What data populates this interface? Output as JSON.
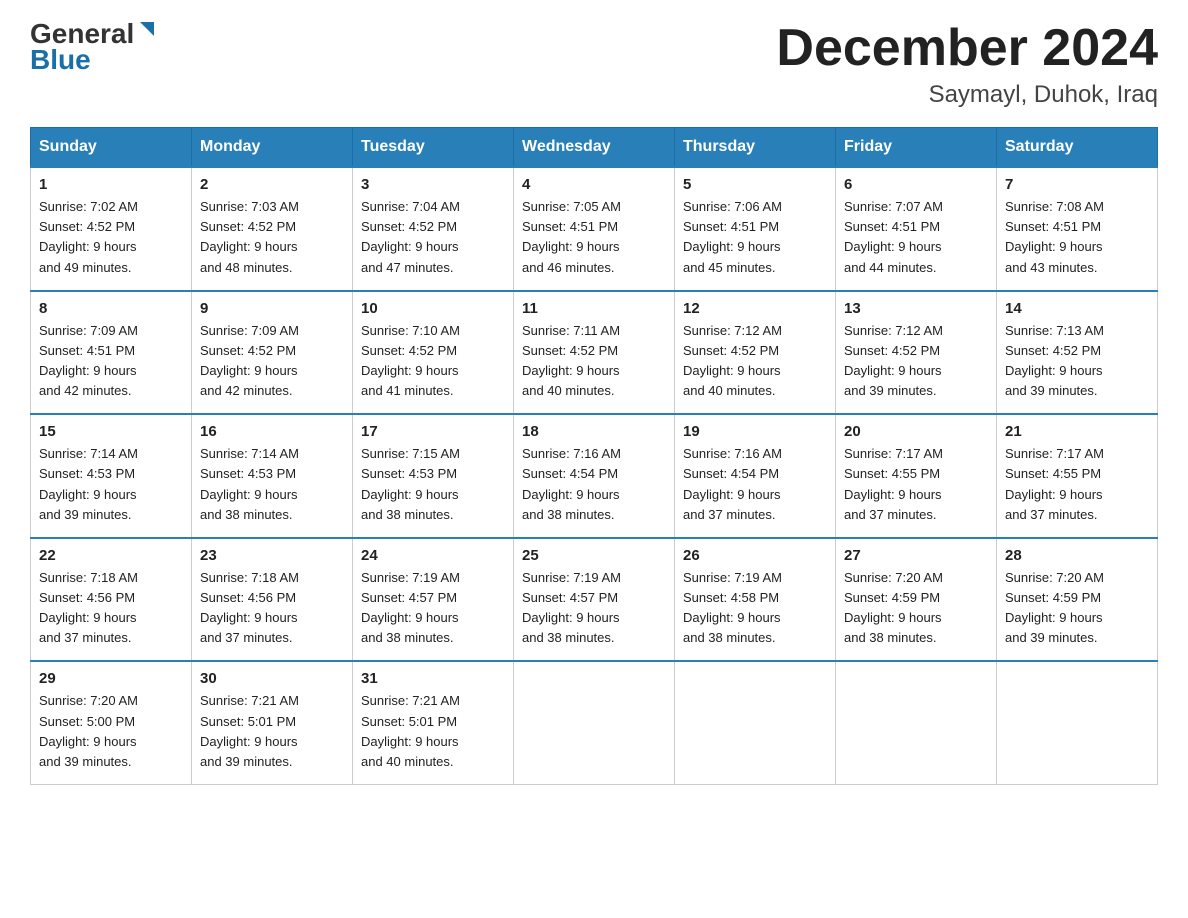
{
  "header": {
    "logo_general": "General",
    "logo_blue": "Blue",
    "month_title": "December 2024",
    "location": "Saymayl, Duhok, Iraq"
  },
  "days_of_week": [
    "Sunday",
    "Monday",
    "Tuesday",
    "Wednesday",
    "Thursday",
    "Friday",
    "Saturday"
  ],
  "weeks": [
    [
      {
        "day": "1",
        "sunrise": "7:02 AM",
        "sunset": "4:52 PM",
        "daylight": "9 hours and 49 minutes."
      },
      {
        "day": "2",
        "sunrise": "7:03 AM",
        "sunset": "4:52 PM",
        "daylight": "9 hours and 48 minutes."
      },
      {
        "day": "3",
        "sunrise": "7:04 AM",
        "sunset": "4:52 PM",
        "daylight": "9 hours and 47 minutes."
      },
      {
        "day": "4",
        "sunrise": "7:05 AM",
        "sunset": "4:51 PM",
        "daylight": "9 hours and 46 minutes."
      },
      {
        "day": "5",
        "sunrise": "7:06 AM",
        "sunset": "4:51 PM",
        "daylight": "9 hours and 45 minutes."
      },
      {
        "day": "6",
        "sunrise": "7:07 AM",
        "sunset": "4:51 PM",
        "daylight": "9 hours and 44 minutes."
      },
      {
        "day": "7",
        "sunrise": "7:08 AM",
        "sunset": "4:51 PM",
        "daylight": "9 hours and 43 minutes."
      }
    ],
    [
      {
        "day": "8",
        "sunrise": "7:09 AM",
        "sunset": "4:51 PM",
        "daylight": "9 hours and 42 minutes."
      },
      {
        "day": "9",
        "sunrise": "7:09 AM",
        "sunset": "4:52 PM",
        "daylight": "9 hours and 42 minutes."
      },
      {
        "day": "10",
        "sunrise": "7:10 AM",
        "sunset": "4:52 PM",
        "daylight": "9 hours and 41 minutes."
      },
      {
        "day": "11",
        "sunrise": "7:11 AM",
        "sunset": "4:52 PM",
        "daylight": "9 hours and 40 minutes."
      },
      {
        "day": "12",
        "sunrise": "7:12 AM",
        "sunset": "4:52 PM",
        "daylight": "9 hours and 40 minutes."
      },
      {
        "day": "13",
        "sunrise": "7:12 AM",
        "sunset": "4:52 PM",
        "daylight": "9 hours and 39 minutes."
      },
      {
        "day": "14",
        "sunrise": "7:13 AM",
        "sunset": "4:52 PM",
        "daylight": "9 hours and 39 minutes."
      }
    ],
    [
      {
        "day": "15",
        "sunrise": "7:14 AM",
        "sunset": "4:53 PM",
        "daylight": "9 hours and 39 minutes."
      },
      {
        "day": "16",
        "sunrise": "7:14 AM",
        "sunset": "4:53 PM",
        "daylight": "9 hours and 38 minutes."
      },
      {
        "day": "17",
        "sunrise": "7:15 AM",
        "sunset": "4:53 PM",
        "daylight": "9 hours and 38 minutes."
      },
      {
        "day": "18",
        "sunrise": "7:16 AM",
        "sunset": "4:54 PM",
        "daylight": "9 hours and 38 minutes."
      },
      {
        "day": "19",
        "sunrise": "7:16 AM",
        "sunset": "4:54 PM",
        "daylight": "9 hours and 37 minutes."
      },
      {
        "day": "20",
        "sunrise": "7:17 AM",
        "sunset": "4:55 PM",
        "daylight": "9 hours and 37 minutes."
      },
      {
        "day": "21",
        "sunrise": "7:17 AM",
        "sunset": "4:55 PM",
        "daylight": "9 hours and 37 minutes."
      }
    ],
    [
      {
        "day": "22",
        "sunrise": "7:18 AM",
        "sunset": "4:56 PM",
        "daylight": "9 hours and 37 minutes."
      },
      {
        "day": "23",
        "sunrise": "7:18 AM",
        "sunset": "4:56 PM",
        "daylight": "9 hours and 37 minutes."
      },
      {
        "day": "24",
        "sunrise": "7:19 AM",
        "sunset": "4:57 PM",
        "daylight": "9 hours and 38 minutes."
      },
      {
        "day": "25",
        "sunrise": "7:19 AM",
        "sunset": "4:57 PM",
        "daylight": "9 hours and 38 minutes."
      },
      {
        "day": "26",
        "sunrise": "7:19 AM",
        "sunset": "4:58 PM",
        "daylight": "9 hours and 38 minutes."
      },
      {
        "day": "27",
        "sunrise": "7:20 AM",
        "sunset": "4:59 PM",
        "daylight": "9 hours and 38 minutes."
      },
      {
        "day": "28",
        "sunrise": "7:20 AM",
        "sunset": "4:59 PM",
        "daylight": "9 hours and 39 minutes."
      }
    ],
    [
      {
        "day": "29",
        "sunrise": "7:20 AM",
        "sunset": "5:00 PM",
        "daylight": "9 hours and 39 minutes."
      },
      {
        "day": "30",
        "sunrise": "7:21 AM",
        "sunset": "5:01 PM",
        "daylight": "9 hours and 39 minutes."
      },
      {
        "day": "31",
        "sunrise": "7:21 AM",
        "sunset": "5:01 PM",
        "daylight": "9 hours and 40 minutes."
      },
      null,
      null,
      null,
      null
    ]
  ],
  "labels": {
    "sunrise": "Sunrise:",
    "sunset": "Sunset:",
    "daylight": "Daylight:"
  }
}
